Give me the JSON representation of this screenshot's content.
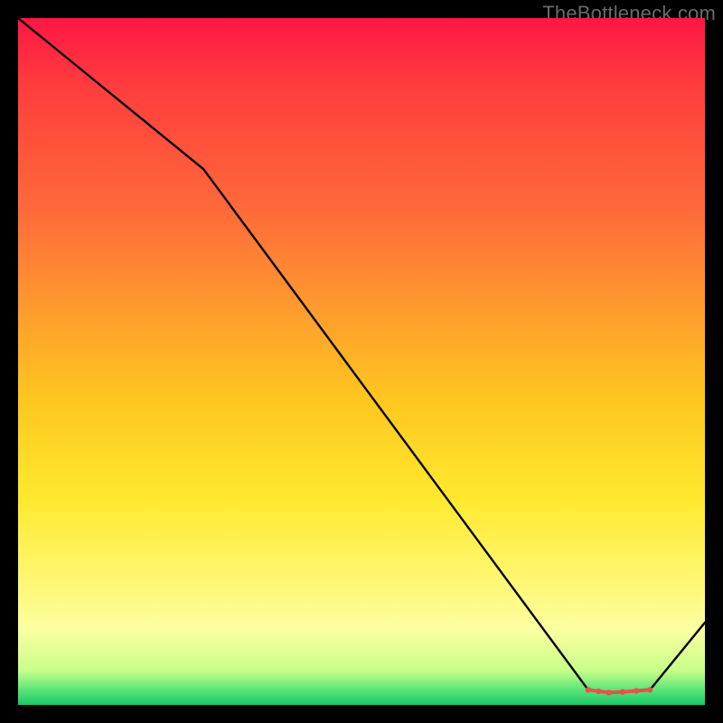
{
  "watermark": "TheBottleneck.com",
  "chart_data": {
    "type": "line",
    "title": "",
    "xlabel": "",
    "ylabel": "",
    "xlim": [
      0,
      100
    ],
    "ylim": [
      0,
      100
    ],
    "series": [
      {
        "name": "curve",
        "color": "#000000",
        "x": [
          0,
          27,
          83,
          86,
          92,
          100
        ],
        "values": [
          100,
          78,
          2.2,
          1.8,
          2.2,
          12
        ]
      }
    ],
    "flat_segment_markers": {
      "color": "#e6534a",
      "x": [
        83,
        84.5,
        86,
        88,
        90,
        92
      ],
      "y": [
        2.2,
        2.0,
        1.8,
        1.9,
        2.05,
        2.2
      ]
    }
  }
}
